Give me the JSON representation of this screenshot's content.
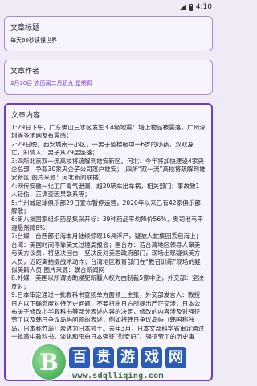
{
  "status_bar": {
    "time": "4:10"
  },
  "title_card": {
    "label": "文章标题",
    "value": "每天60秒读懂世界"
  },
  "author_card": {
    "label": "文章作者",
    "value": "3月30日 农历闰二月初九 星期四"
  },
  "content_card": {
    "label": "文章内容",
    "items": [
      "1:29日下午，广东佛山三水区发生3.4级地震：墙上物品被震落，广州深圳等多地网友有震感；",
      "2:29日晚，西安城南一小区，一男子坠楼砸中一6岁的小孩，双双身亡，知情人：男子从29层坠落；",
      "3:四所北京双一流高校将疏解到雄安新区。河北：今年将加快建设4家央企总部，争取30家央企子公司落户雄安；［四所“双一流”高校将疏解到雄安新区 图片来源：河北新闻联播］",
      "4:网传安徽一化工厂毒气泄漏，超20辆车出车祸，相关部门：事故致1人轻伤，正调查因果联系等；",
      "5:广州城足球俱乐部29日宣布暂停运营，2020年以来已有42家俱乐部解散；",
      "6:第八批国家组织药品集采开标：39种药品平均降价56%，奥司他韦干混悬剂降8%；",
      "7:台媒：台西部沿海本月陆续惊现16具浮尸，疑被人蛇集团丢包海上；台湾：美国时间停靠美文过境周报会；国台办：若台湾地区领导人窜美与美方议员，将坚决回击；坚决反对美国政府部门，现场出现疑似美方人员，近距离拍摄战术动作；台湾地区教育部门在“教召训练”现场的疑似美籍人员 图片来源：联合新闻网",
      "8:外媒：美国以所谓协助侵犯新疆人权为由制裁5家中企，外交部：坚决反对；",
      "9:日本审定通过一批教科书宣扬单方面领土主张，外交部发言人：教授日方以正确态度对待历史问题，不要扭曲日方所提出严正交涉；日本公布关于修改小学教科书等部分表述内容的决定，修改的内容涉及对强征劳工以及韩日争议岛屿问题的表述，例如将韩日争议岛屿（韩国称独岛，日本称竹岛）表述为日本领土。去年3月，日本文部科学省审定通过一批高中教科书，淡化和歪曲日本强征“慰安妇”、强征劳工的历史事"
    ]
  },
  "watermark": {
    "logo_letter": "B",
    "chars": [
      "百",
      "贵",
      "游",
      "戏",
      "网"
    ],
    "url": "www.sdqlliqing.com"
  }
}
